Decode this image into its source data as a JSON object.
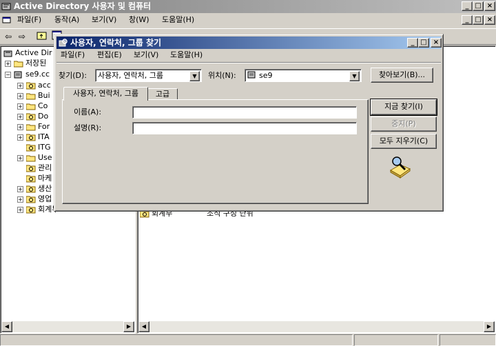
{
  "main_window": {
    "title": "Active Directory 사용자 및 컴퓨터",
    "menu": [
      "파일(F)",
      "동작(A)",
      "보기(V)",
      "창(W)",
      "도움말(H)"
    ],
    "inner_menu_close": "_|□|×"
  },
  "tree": {
    "root_label": "Active Directory 사용자 및 컴퓨터",
    "root_visible": "Active Dir",
    "saved_queries": "저장된",
    "domain": "se9.cc",
    "items": [
      "acc",
      "Bui",
      "Co",
      "Do",
      "For",
      "ITA",
      "ITG",
      "Use",
      "관리",
      "마케",
      "생산",
      "영업",
      "회계부"
    ]
  },
  "details": {
    "row_name": "회계부",
    "row_type": "조직 구성 단위"
  },
  "dialog": {
    "title": "사용자, 연락처, 그룹 찾기",
    "menu": [
      "파일(F)",
      "편집(E)",
      "보기(V)",
      "도움말(H)"
    ],
    "find_label": "찾기(D):",
    "find_value": "사용자, 연락처, 그룹",
    "in_label": "위치(N):",
    "in_value": "se9",
    "browse_button": "찾아보기(B)...",
    "tabs": [
      "사용자, 연락처, 그룹",
      "고급"
    ],
    "name_label": "이름(A):",
    "name_value": "",
    "desc_label": "설명(R):",
    "desc_value": "",
    "find_now_button": "지금 찾기(I)",
    "stop_button": "중지(P)",
    "clear_all_button": "모두 지우기(C)"
  },
  "colors": {
    "face": "#d4d0c8",
    "active_title": "#0a246a",
    "inactive_title": "#808080"
  }
}
